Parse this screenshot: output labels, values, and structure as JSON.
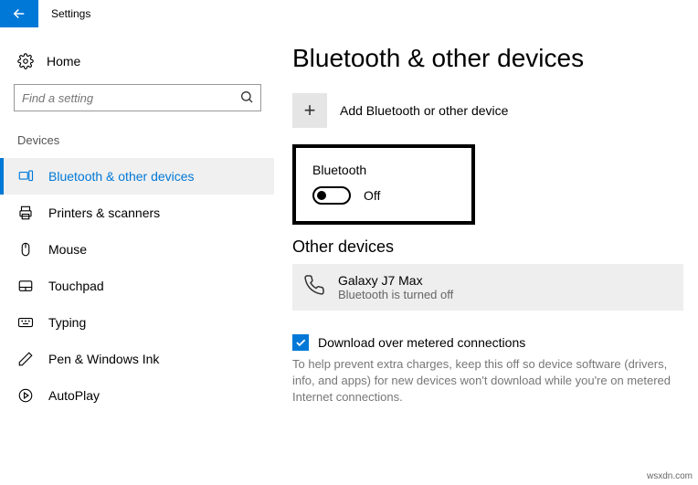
{
  "titlebar": {
    "title": "Settings"
  },
  "sidebar": {
    "home_label": "Home",
    "search_placeholder": "Find a setting",
    "section_label": "Devices",
    "items": [
      {
        "label": "Bluetooth & other devices"
      },
      {
        "label": "Printers & scanners"
      },
      {
        "label": "Mouse"
      },
      {
        "label": "Touchpad"
      },
      {
        "label": "Typing"
      },
      {
        "label": "Pen & Windows Ink"
      },
      {
        "label": "AutoPlay"
      }
    ]
  },
  "main": {
    "heading": "Bluetooth & other devices",
    "add_label": "Add Bluetooth or other device",
    "bluetooth": {
      "label": "Bluetooth",
      "state": "Off"
    },
    "other_devices_heading": "Other devices",
    "device": {
      "name": "Galaxy J7 Max",
      "status": "Bluetooth is turned off"
    },
    "metered": {
      "label": "Download over metered connections",
      "desc": "To help prevent extra charges, keep this off so device software (drivers, info, and apps) for new devices won't download while you're on metered Internet connections."
    }
  },
  "footer": "wsxdn.com"
}
